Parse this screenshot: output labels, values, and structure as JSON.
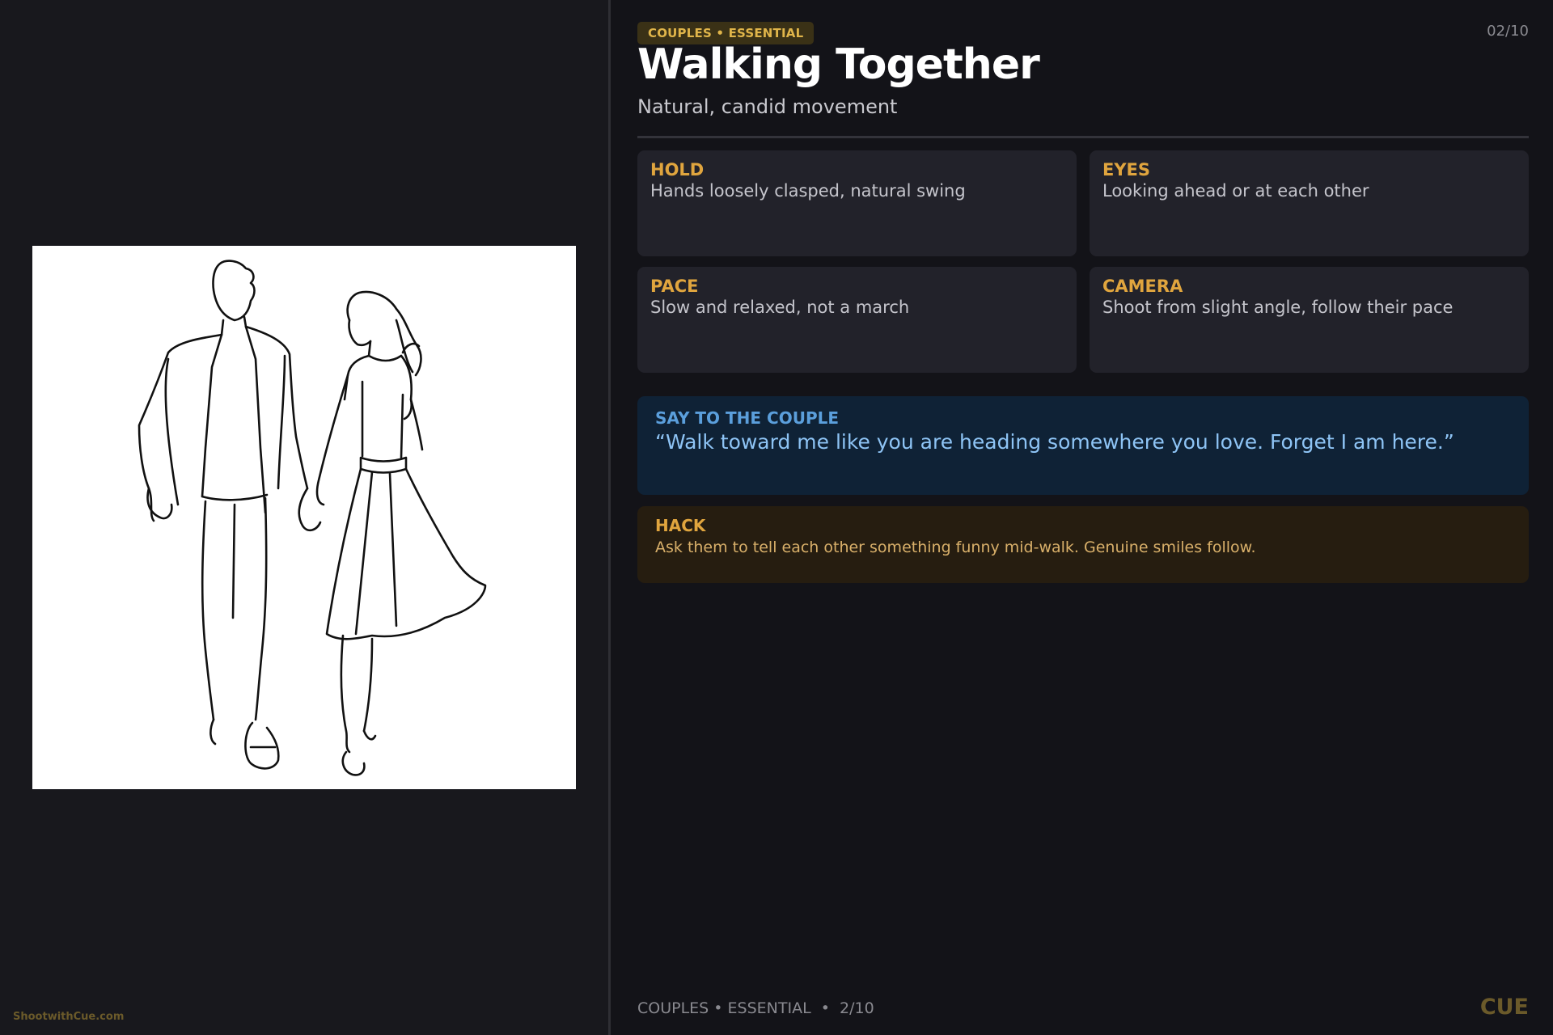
{
  "badge": "COUPLES • ESSENTIAL",
  "counter": "02/10",
  "title": "Walking Together",
  "subtitle": "Natural, candid movement",
  "tips": [
    {
      "label": "HOLD",
      "text": "Hands loosely clasped, natural swing"
    },
    {
      "label": "EYES",
      "text": "Looking ahead or at each other"
    },
    {
      "label": "PACE",
      "text": "Slow and relaxed, not a march"
    },
    {
      "label": "CAMERA",
      "text": "Shoot from slight angle, follow their pace"
    }
  ],
  "say": {
    "label": "SAY TO THE COUPLE",
    "text": "“Walk toward me like you are heading somewhere you love. Forget I am here.”"
  },
  "hack": {
    "label": "HACK",
    "text": "Ask them to tell each other something funny mid-walk. Genuine smiles follow."
  },
  "footer": "COUPLES • ESSENTIAL  •  2/10",
  "brand": "CUE",
  "site": "ShootwithCue.com",
  "colors": {
    "accent": "#e0a53e",
    "say_text": "#8ec4f5",
    "background": "#131318"
  }
}
